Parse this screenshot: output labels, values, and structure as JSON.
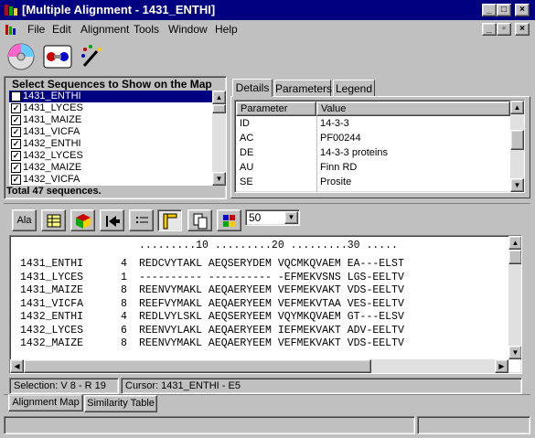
{
  "window": {
    "title": "[Multiple Alignment - 1431_ENTHI]"
  },
  "menu": [
    "File",
    "Edit",
    "Alignment",
    "Tools",
    "Window",
    "Help"
  ],
  "seq_panel": {
    "header": "Select Sequences to Show on the Map",
    "items": [
      "1431_ENTHI",
      "1431_LYCES",
      "1431_MAIZE",
      "1431_VICFA",
      "1432_ENTHI",
      "1432_LYCES",
      "1432_MAIZE",
      "1432_VICFA"
    ],
    "footer": "Total 47 sequences."
  },
  "details": {
    "tabs": [
      "Details",
      "Parameters",
      "Legend"
    ],
    "columns": [
      "Parameter",
      "Value"
    ],
    "rows": [
      {
        "p": "ID",
        "v": "14-3-3"
      },
      {
        "p": "AC",
        "v": "PF00244"
      },
      {
        "p": "DE",
        "v": "14-3-3 proteins"
      },
      {
        "p": "AU",
        "v": "Finn RD"
      },
      {
        "p": "SE",
        "v": "Prosite"
      }
    ]
  },
  "toolbar2": {
    "ala_label": "Ala",
    "zoom_value": "50"
  },
  "alignment": {
    "ruler": ".........10 .........20 .........30 .....",
    "rows": [
      {
        "name": "1431_ENTHI",
        "start": "4",
        "seq": "REDCVYTAKL AEQSERYDEM VQCMKQVAEM EA---ELST"
      },
      {
        "name": "1431_LYCES",
        "start": "1",
        "seq": "---------- ---------- -EFMEKVSNS LGS-EELTV"
      },
      {
        "name": "1431_MAIZE",
        "start": "8",
        "seq": "REENVYMAKL AEQAERYEEM VEFMEKVAKT VDS-EELTV"
      },
      {
        "name": "1431_VICFA",
        "start": "8",
        "seq": "REEFVYMAKL AEQAERYEEM VEFMEKVTAA VES-EELTV"
      },
      {
        "name": "1432_ENTHI",
        "start": "4",
        "seq": "REDLVYLSKL AEQSERYEEM VQYMKQVAEM GT---ELSV"
      },
      {
        "name": "1432_LYCES",
        "start": "6",
        "seq": "REENVYLAKL AEQAERYEEM IEFMEKVAKT ADV-EELTV"
      },
      {
        "name": "1432_MAIZE",
        "start": "8",
        "seq": "REENVYMAKL AEQAERYEEM VEFMEKVAKT VDS-EELTV"
      }
    ]
  },
  "status": {
    "selection": "Selection: V 8 - R 19",
    "cursor": "Cursor: 1431_ENTHI - E5"
  },
  "bottom_tabs": [
    "Alignment Map",
    "Similarity Table"
  ],
  "colors": {
    "title_bg": "#000080",
    "face": "#c0c0c0",
    "selection": "#000080"
  }
}
